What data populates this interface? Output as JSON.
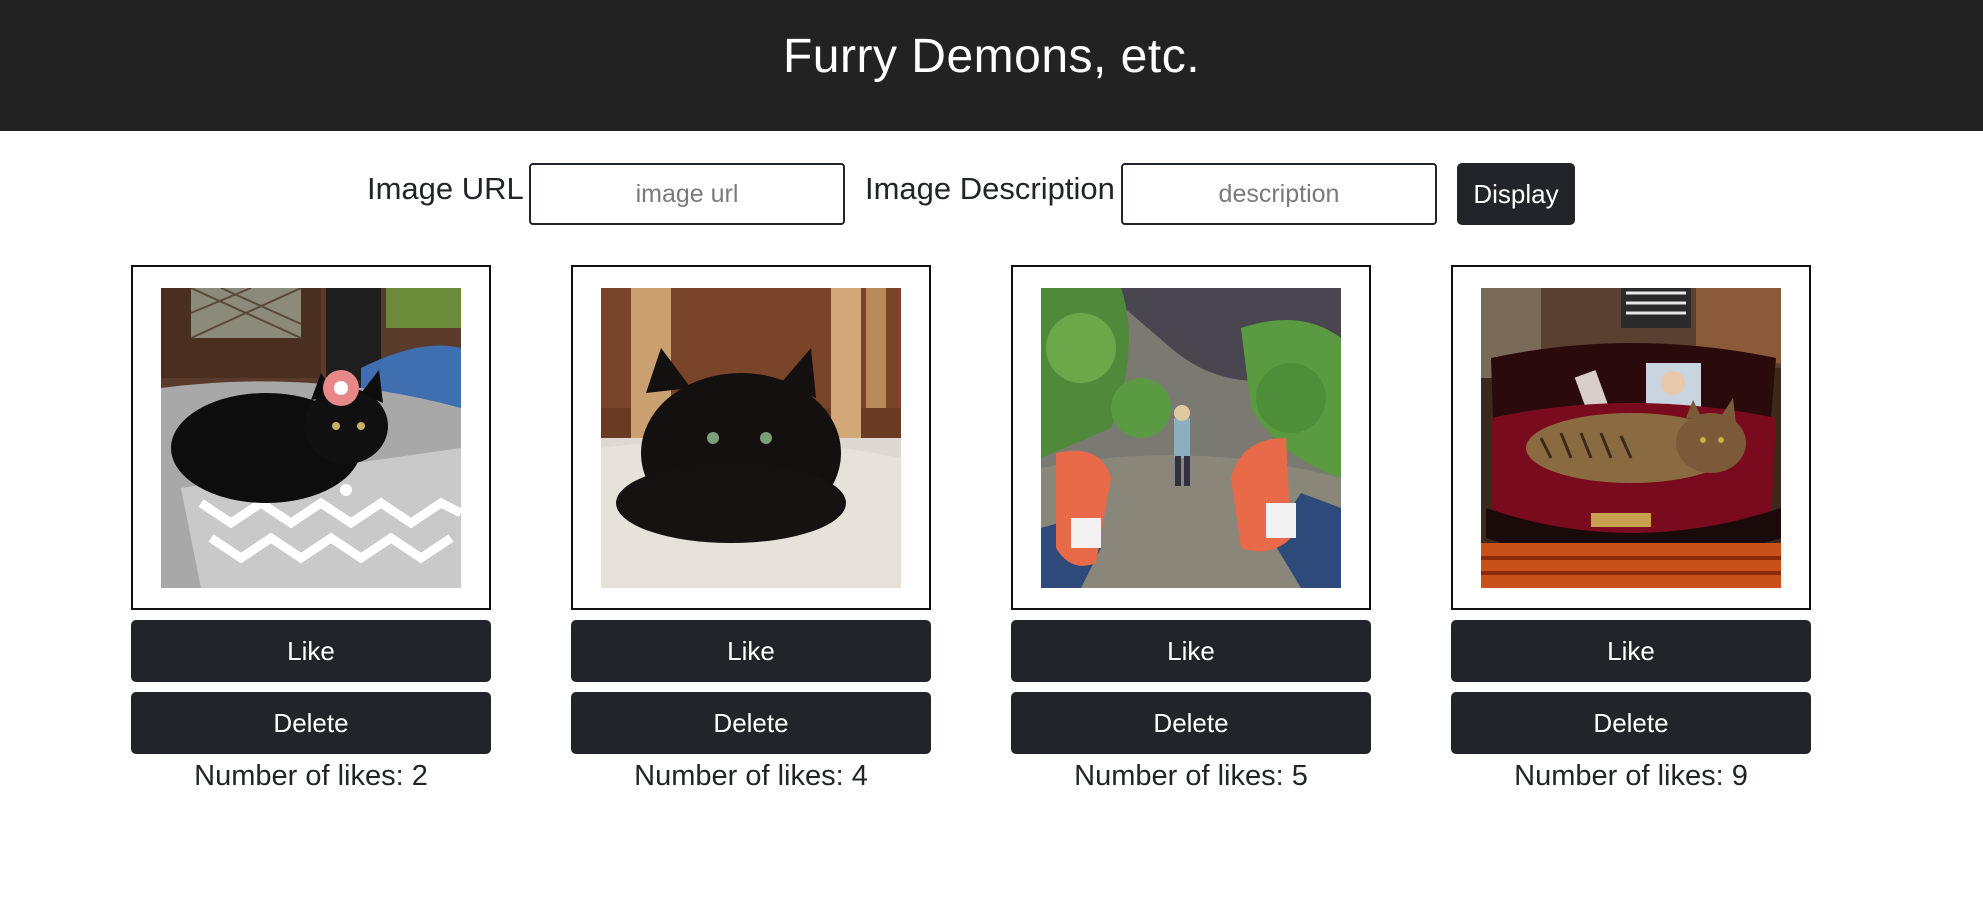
{
  "header": {
    "title": "Furry Demons, etc."
  },
  "form": {
    "url_label": "Image URL",
    "url_placeholder": "image url",
    "url_value": "",
    "description_label": "Image Description",
    "description_placeholder": "description",
    "description_value": "",
    "display_label": "Display"
  },
  "cards": [
    {
      "like_label": "Like",
      "delete_label": "Delete",
      "likes_prefix": "Number of likes:",
      "likes": 2,
      "likes_text": "Number of likes: 2"
    },
    {
      "like_label": "Like",
      "delete_label": "Delete",
      "likes_prefix": "Number of likes:",
      "likes": 4,
      "likes_text": "Number of likes: 4"
    },
    {
      "like_label": "Like",
      "delete_label": "Delete",
      "likes_prefix": "Number of likes:",
      "likes": 5,
      "likes_text": "Number of likes: 5"
    },
    {
      "like_label": "Like",
      "delete_label": "Delete",
      "likes_prefix": "Number of likes:",
      "likes": 9,
      "likes_text": "Number of likes: 9"
    }
  ],
  "colors": {
    "header_bg": "#222222",
    "button_bg": "#212529",
    "text": "#212529"
  }
}
